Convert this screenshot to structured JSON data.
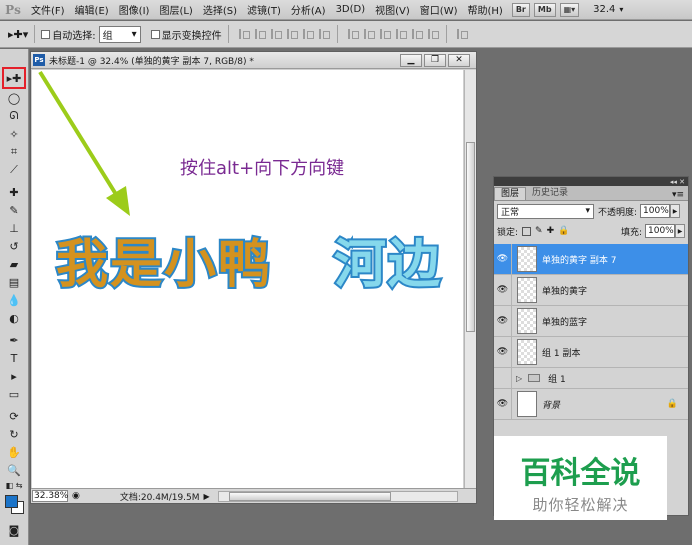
{
  "app": {
    "logo": "Ps"
  },
  "menubar": {
    "items": [
      "文件(F)",
      "编辑(E)",
      "图像(I)",
      "图层(L)",
      "选择(S)",
      "滤镜(T)",
      "分析(A)",
      "3D(D)",
      "视图(V)",
      "窗口(W)",
      "帮助(H)"
    ],
    "bridge_btn": "Br",
    "minibridge_btn": "Mb",
    "zoom": "32.4"
  },
  "options": {
    "auto_select_label": "自动选择:",
    "auto_select_value": "组",
    "show_transform_label": "显示变换控件"
  },
  "document": {
    "title": "未标题-1 @ 32.4% (单独的黄字 副本 7, RGB/8) *",
    "annotation": "按住alt+向下方向键",
    "yellow_text": "我是小鸭",
    "blue_text": "河边",
    "zoom_field": "32.38%",
    "doc_size": "文档:20.4M/19.5M"
  },
  "layers_panel": {
    "tabs": [
      "图层",
      "历史记录"
    ],
    "blend_mode": "正常",
    "opacity_label": "不透明度:",
    "opacity_value": "100%",
    "lock_label": "锁定:",
    "fill_label": "填充:",
    "fill_value": "100%",
    "layers": [
      {
        "name": "单独的黄字 副本 7",
        "selected": true
      },
      {
        "name": "单独的黄字"
      },
      {
        "name": "单独的蓝字"
      },
      {
        "name": "组 1 副本"
      },
      {
        "name": "组 1"
      },
      {
        "name": "背景"
      }
    ]
  },
  "watermark": {
    "title": "百科全说",
    "subtitle": "助你轻松解决"
  },
  "colors": {
    "accent": "#3d8fe8",
    "annotation": "#7a2a92",
    "arrow": "#9ccc1a",
    "highlight": "#e4202a"
  }
}
